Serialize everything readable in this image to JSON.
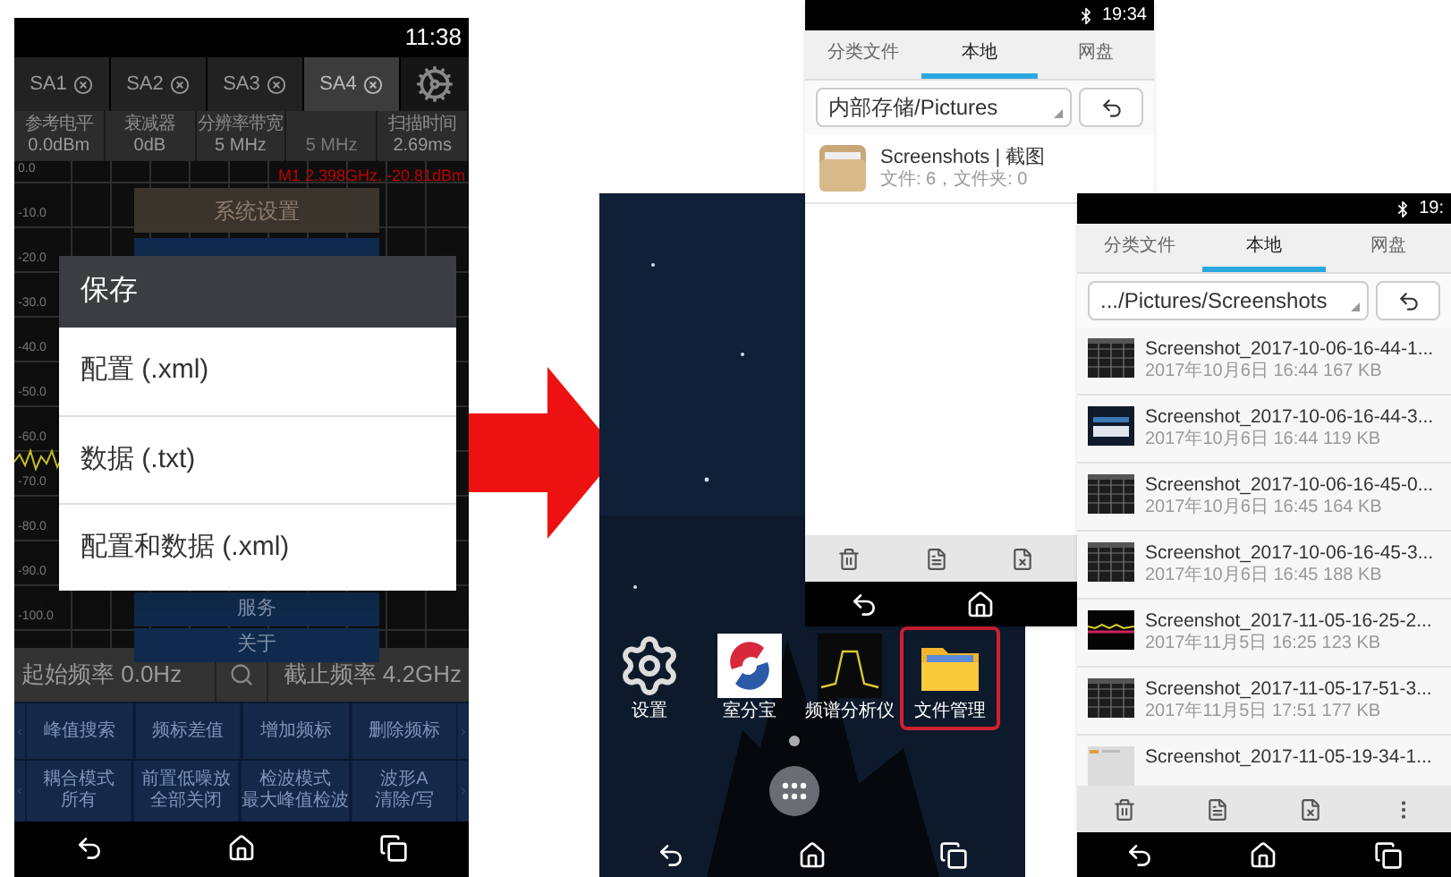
{
  "spectrum_app": {
    "status_bar": {
      "time": "11:38"
    },
    "tabs": [
      {
        "label": "SA1",
        "selected": false
      },
      {
        "label": "SA2",
        "selected": false
      },
      {
        "label": "SA3",
        "selected": false
      },
      {
        "label": "SA4",
        "selected": true
      }
    ],
    "params": [
      {
        "label": "参考电平",
        "value": "0.0dBm",
        "disabled": false
      },
      {
        "label": "衰减器",
        "value": "0dB",
        "disabled": false
      },
      {
        "label": "分辨率带宽",
        "value": "5 MHz",
        "disabled": false
      },
      {
        "value": "5 MHz",
        "disabled": true
      },
      {
        "label": "扫描时间",
        "value": "2.69ms",
        "disabled": false
      }
    ],
    "y_labels": [
      "0.0",
      "-10.0",
      "-20.0",
      "-30.0",
      "-40.0",
      "-50.0",
      "-60.0",
      "-70.0",
      "-80.0",
      "-90.0",
      "-100.0"
    ],
    "marker": "M1 2.398GHz, -20.81dBm",
    "menu": [
      {
        "label": "系统设置",
        "selected": true
      },
      {
        "selected": false
      },
      {
        "label": "服务",
        "selected": false
      },
      {
        "label": "关于",
        "selected": false
      }
    ],
    "dialog": {
      "title": "保存",
      "items": [
        "配置 (.xml)",
        "数据 (.txt)",
        "配置和数据 (.xml)"
      ]
    },
    "start_freq": "起始频率 0.0Hz",
    "stop_freq": "截止频率 4.2GHz",
    "soft_keys": [
      [
        {
          "lines": [
            "峰值搜索"
          ]
        },
        {
          "lines": [
            "频标差值"
          ]
        },
        {
          "lines": [
            "增加频标"
          ]
        },
        {
          "lines": [
            "删除频标"
          ]
        }
      ],
      [
        {
          "lines": [
            "耦合模式",
            "所有"
          ]
        },
        {
          "lines": [
            "前置低噪放",
            "全部关闭"
          ]
        },
        {
          "lines": [
            "检波模式",
            "最大峰值检波"
          ]
        },
        {
          "lines": [
            "波形A",
            "清除/写"
          ]
        }
      ]
    ]
  },
  "home_screen": {
    "apps": [
      {
        "label": "设置",
        "kind": "gear",
        "highlighted": false
      },
      {
        "label": "室分宝",
        "kind": "logo",
        "highlighted": false
      },
      {
        "label": "频谱分析仪",
        "kind": "spectrum",
        "highlighted": false
      },
      {
        "label": "文件管理",
        "kind": "folder",
        "highlighted": true
      }
    ]
  },
  "file_manager_pictures": {
    "status_bar": {
      "time": "19:34"
    },
    "tabs": [
      {
        "label": "分类文件",
        "selected": false
      },
      {
        "label": "本地",
        "selected": true
      },
      {
        "label": "网盘",
        "selected": false
      }
    ],
    "path": "内部存储/Pictures",
    "folders": [
      {
        "name": "Screenshots | 截图",
        "info": "文件: 6，文件夹: 0"
      }
    ]
  },
  "file_manager_screenshots": {
    "status_bar": {
      "time": "19:"
    },
    "tabs": [
      {
        "label": "分类文件",
        "selected": false
      },
      {
        "label": "本地",
        "selected": true
      },
      {
        "label": "网盘",
        "selected": false
      }
    ],
    "path": ".../Pictures/Screenshots",
    "files": [
      {
        "name": "Screenshot_2017-10-06-16-44-1...",
        "info": "2017年10月6日 16:44 167 KB",
        "kind": "grid"
      },
      {
        "name": "Screenshot_2017-10-06-16-44-3...",
        "info": "2017年10月6日 16:44 119 KB",
        "kind": "dialog"
      },
      {
        "name": "Screenshot_2017-10-06-16-45-0...",
        "info": "2017年10月6日 16:45 164 KB",
        "kind": "grid"
      },
      {
        "name": "Screenshot_2017-10-06-16-45-3...",
        "info": "2017年10月6日 16:45 188 KB",
        "kind": "grid"
      },
      {
        "name": "Screenshot_2017-11-05-16-25-2...",
        "info": "2017年11月5日 16:25 123 KB",
        "kind": "trace"
      },
      {
        "name": "Screenshot_2017-11-05-17-51-3...",
        "info": "2017年11月5日 17:51 177 KB",
        "kind": "grid"
      },
      {
        "name": "Screenshot_2017-11-05-19-34-1...",
        "kind": "light"
      }
    ]
  }
}
